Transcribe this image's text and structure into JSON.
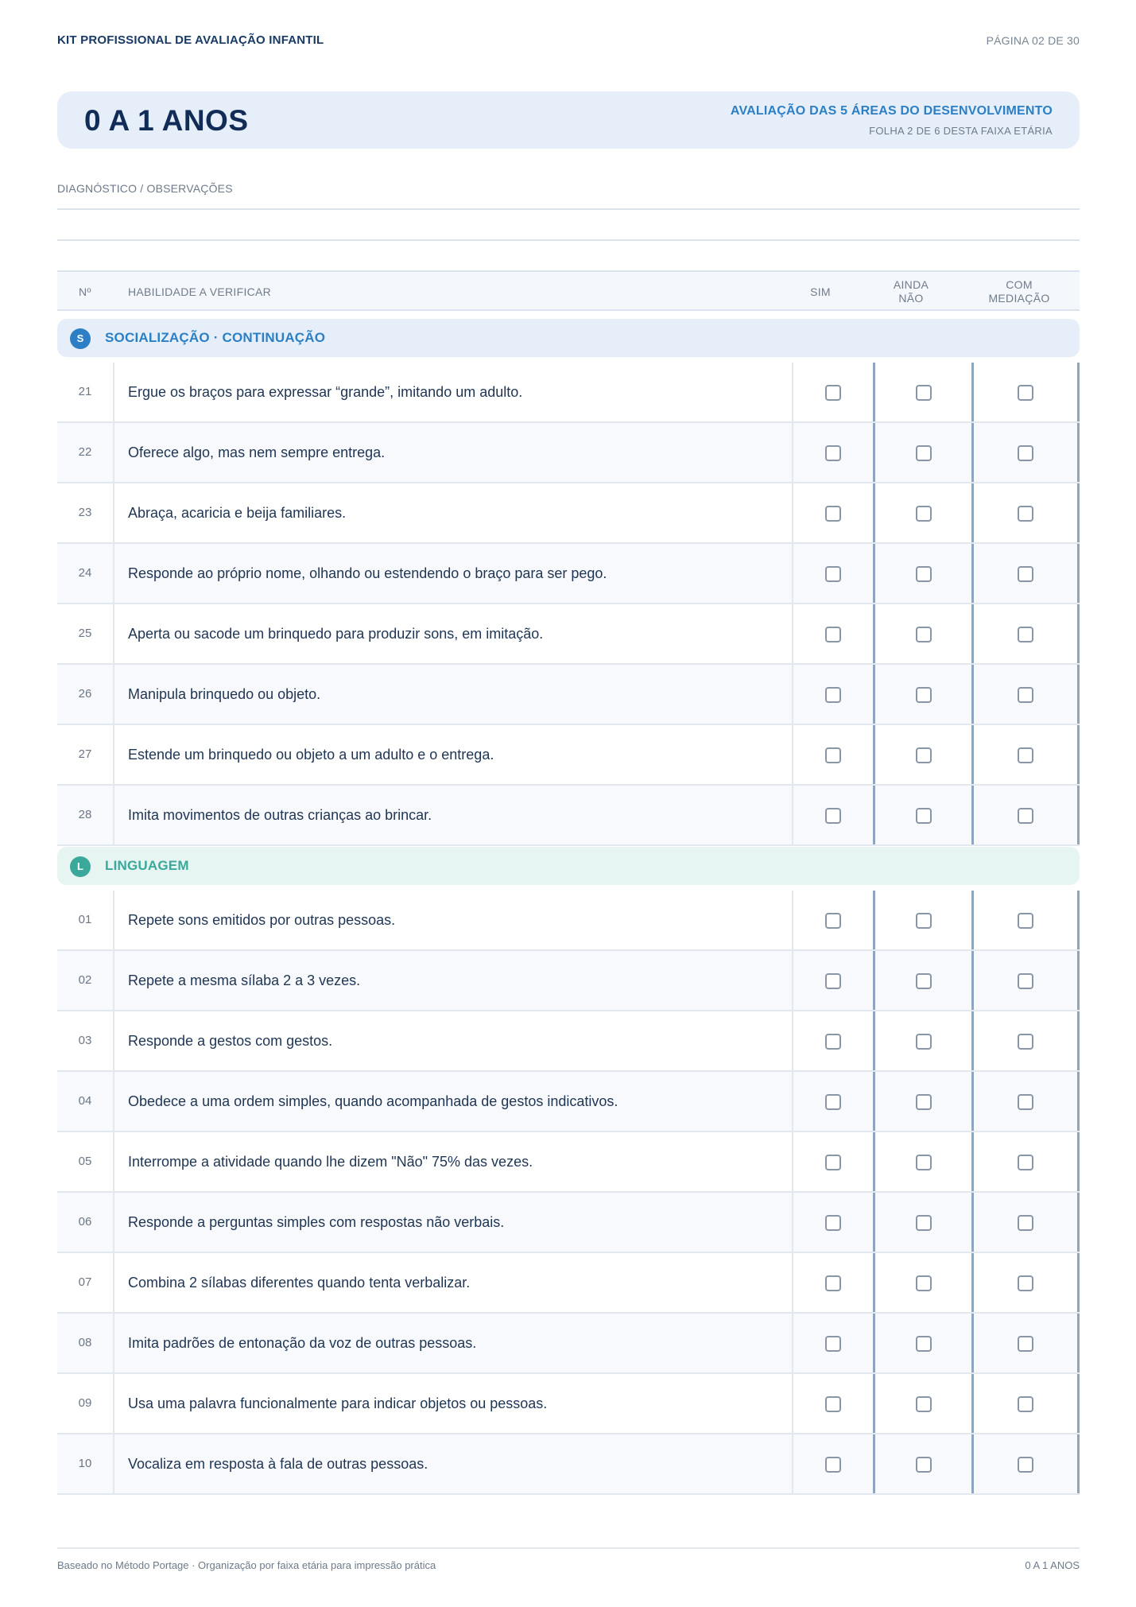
{
  "header": {
    "title": "KIT PROFISSIONAL DE AVALIAÇÃO INFANTIL",
    "page": "PÁGINA 02 DE 30"
  },
  "banner": {
    "age_range": "0 A 1 ANOS",
    "subtitle": "AVALIAÇÃO DAS 5 ÁREAS DO DESENVOLVIMENTO",
    "sheet": "FOLHA 2 DE 6 DESTA FAIXA ETÁRIA"
  },
  "diagnosis": {
    "label": "DIAGNÓSTICO / OBSERVAÇÕES"
  },
  "table": {
    "col_no": "Nº",
    "col_skill": "HABILIDADE A VERIFICAR",
    "col_sim": "SIM",
    "col_ainda_1": "AINDA",
    "col_ainda_2": "NÃO",
    "col_com_1": "COM",
    "col_com_2": "MEDIAÇÃO"
  },
  "sections": [
    {
      "badge": "S",
      "title": "SOCIALIZAÇÃO · CONTINUAÇÃO",
      "items": [
        {
          "no": "21",
          "text": "Ergue os braços para expressar “grande”, imitando um adulto."
        },
        {
          "no": "22",
          "text": "Oferece algo, mas nem sempre entrega."
        },
        {
          "no": "23",
          "text": "Abraça, acaricia e beija familiares."
        },
        {
          "no": "24",
          "text": "Responde ao próprio nome, olhando ou estendendo o braço para ser pego."
        },
        {
          "no": "25",
          "text": "Aperta ou sacode um brinquedo para produzir sons, em imitação."
        },
        {
          "no": "26",
          "text": "Manipula brinquedo ou objeto."
        },
        {
          "no": "27",
          "text": "Estende um brinquedo ou objeto a um adulto e o entrega."
        },
        {
          "no": "28",
          "text": "Imita movimentos de outras crianças ao brincar."
        }
      ]
    },
    {
      "badge": "L",
      "title": "LINGUAGEM",
      "items": [
        {
          "no": "01",
          "text": "Repete sons emitidos por outras pessoas."
        },
        {
          "no": "02",
          "text": "Repete a mesma sílaba 2 a 3 vezes."
        },
        {
          "no": "03",
          "text": "Responde a gestos com gestos."
        },
        {
          "no": "04",
          "text": "Obedece a uma ordem simples, quando acompanhada de gestos indicativos."
        },
        {
          "no": "05",
          "text": "Interrompe a atividade quando lhe dizem \"Não\" 75% das vezes."
        },
        {
          "no": "06",
          "text": "Responde a perguntas simples com respostas não verbais."
        },
        {
          "no": "07",
          "text": "Combina 2 sílabas diferentes quando tenta verbalizar."
        },
        {
          "no": "08",
          "text": "Imita padrões de entonação da voz de outras pessoas."
        },
        {
          "no": "09",
          "text": "Usa uma palavra funcionalmente para indicar objetos ou pessoas."
        },
        {
          "no": "10",
          "text": "Vocaliza em resposta à fala de outras pessoas."
        }
      ]
    }
  ],
  "footer": {
    "left": "Baseado no Método Portage · Organização por faixa etária para impressão prática",
    "right": "0 A 1 ANOS"
  }
}
